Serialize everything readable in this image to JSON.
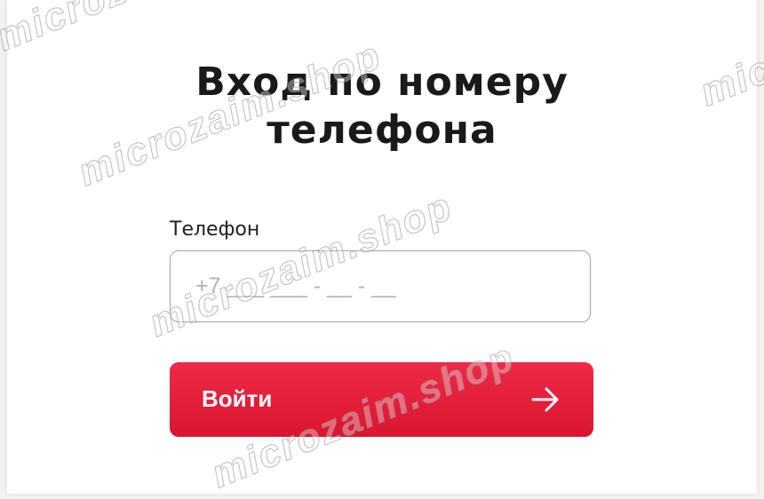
{
  "login_form": {
    "title": "Вход по номеру\nтелефона",
    "phone_label": "Телефон",
    "phone_placeholder": "+7 ___ ___ - __ - __",
    "submit_label": "Войти"
  },
  "watermark": {
    "text": "microzaim.shop"
  },
  "colors": {
    "accent": "#e31e3a",
    "input_border": "#a4a4a8",
    "title_text": "#1a1a1a"
  }
}
